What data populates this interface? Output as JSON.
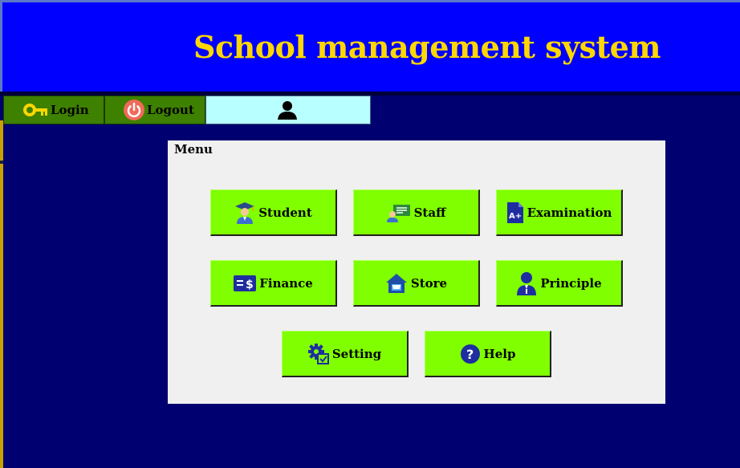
{
  "app": {
    "title": "School management system"
  },
  "toolbar": {
    "login_label": "Login",
    "logout_label": "Logout",
    "user_icon": "user-icon"
  },
  "menu": {
    "label": "Menu",
    "items": [
      {
        "label": "Student",
        "icon": "student-icon"
      },
      {
        "label": "Staff",
        "icon": "staff-icon"
      },
      {
        "label": "Examination",
        "icon": "examination-icon"
      },
      {
        "label": "Finance",
        "icon": "finance-icon"
      },
      {
        "label": "Store",
        "icon": "store-icon"
      },
      {
        "label": "Principle",
        "icon": "principle-icon"
      },
      {
        "label": "Setting",
        "icon": "setting-icon"
      },
      {
        "label": "Help",
        "icon": "help-icon"
      }
    ]
  },
  "colors": {
    "background": "#000070",
    "banner": "#0000ff",
    "title_text": "#ffd700",
    "toolbar_button": "#3e8000",
    "user_panel": "#b8ffff",
    "menu_panel": "#f0f0f0",
    "tile": "#80ff00",
    "icon_blue": "#1e2ea0"
  }
}
